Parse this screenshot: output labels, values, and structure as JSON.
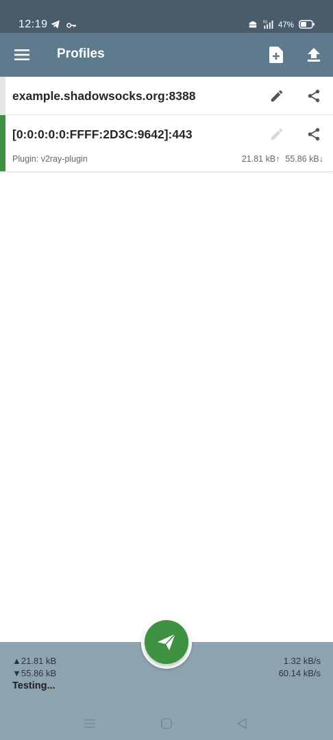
{
  "status_bar": {
    "time": "12:19",
    "battery_percent": "47%",
    "icons": [
      "telegram-icon",
      "key-icon",
      "vpn-icon",
      "signal-icon",
      "battery-icon"
    ],
    "network_label": "5G"
  },
  "app_bar": {
    "title": "Profiles",
    "icons": [
      "menu-icon",
      "add-file-icon",
      "upload-icon"
    ]
  },
  "profiles": [
    {
      "name": "example.shadowsocks.org:8388",
      "selected": false,
      "plugin": "",
      "upload": "",
      "download": ""
    },
    {
      "name": "[0:0:0:0:0:FFFF:2D3C:9642]:443",
      "selected": true,
      "plugin": "Plugin: v2ray-plugin",
      "upload": "21.81 kB↑",
      "download": "55.86 kB↓"
    }
  ],
  "stats": {
    "total_up": "▲21.81 kB",
    "total_down": "▼55.86 kB",
    "status": "Testing...",
    "speed_up": "1.32 kB/s",
    "speed_down": "60.14 kB/s"
  },
  "colors": {
    "status_bar": "#4a5c6a",
    "app_bar": "#5e7a8d",
    "accent_green": "#3d9140",
    "bottom_panel": "#8ea3b0"
  }
}
